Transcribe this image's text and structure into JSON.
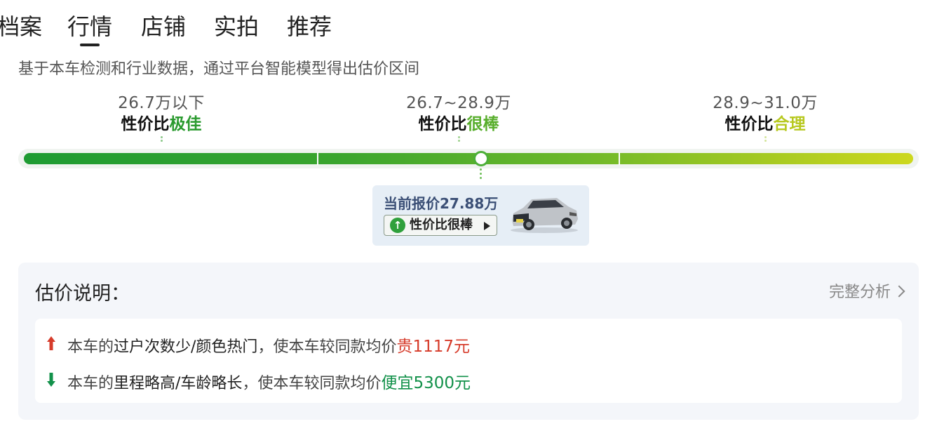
{
  "tabs": [
    {
      "label": "档案"
    },
    {
      "label": "行情",
      "active": true
    },
    {
      "label": "店铺"
    },
    {
      "label": "实拍"
    },
    {
      "label": "推荐"
    }
  ],
  "subtitle": "基于本车检测和行业数据，通过平台智能模型得出估价区间",
  "ranges": [
    {
      "price": "26.7万以下",
      "label_prefix": "性价比",
      "label_hl": "极佳",
      "color": "#2a9a2e"
    },
    {
      "price": "26.7~28.9万",
      "label_prefix": "性价比",
      "label_hl": "很棒",
      "color": "#58ae2c"
    },
    {
      "price": "28.9~31.0万",
      "label_prefix": "性价比",
      "label_hl": "合理",
      "color": "#b7c81f"
    }
  ],
  "quote": {
    "title": "当前报价27.88万",
    "tag": "性价比很棒",
    "price_value": 27.88,
    "range_min": 26.7,
    "range_max": 31.0
  },
  "explanation": {
    "title": "估价说明：",
    "link": "完整分析",
    "reasons": [
      {
        "prefix": "本车的",
        "key": "过户次数少/颜色热门",
        "mid": "，使本车较同款均价",
        "amount": "贵1117元",
        "direction": "up"
      },
      {
        "prefix": "本车的",
        "key": "里程略高/车龄略长",
        "mid": "，使本车较同款均价",
        "amount": "便宜5300元",
        "direction": "down"
      }
    ]
  },
  "colors": {
    "accent_green": "#4caf38",
    "up_red": "#d63b2a",
    "down_green": "#12914a"
  }
}
